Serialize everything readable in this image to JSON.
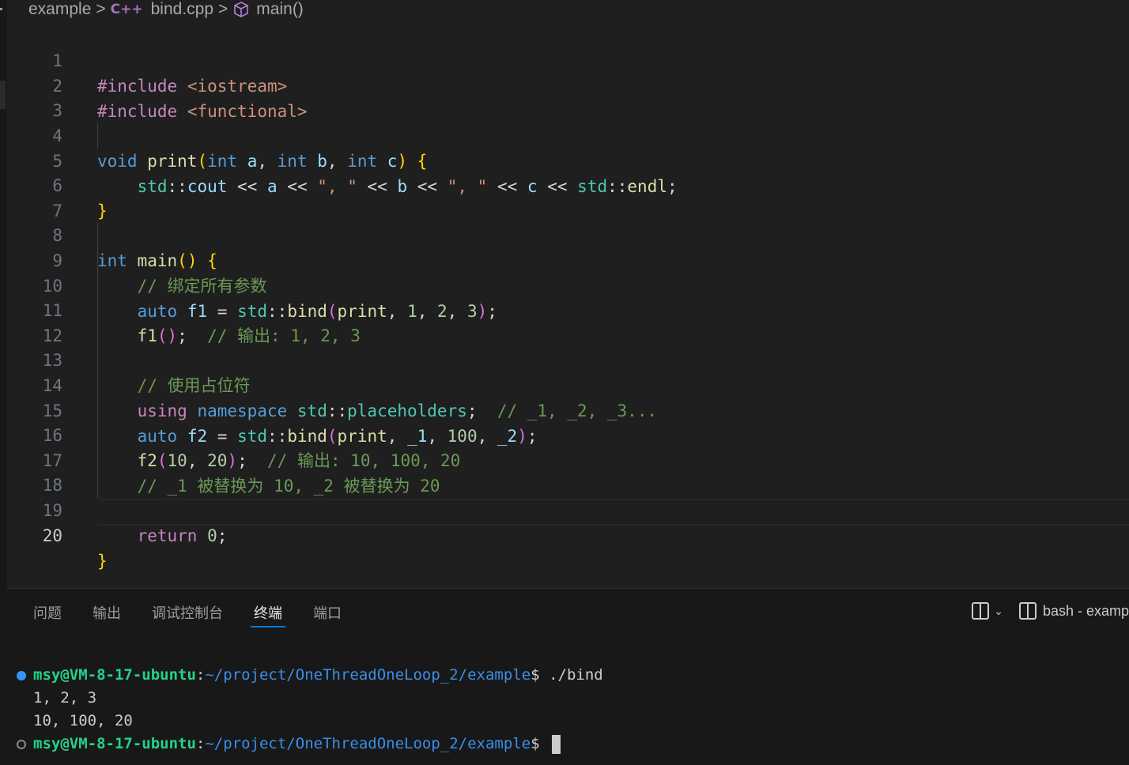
{
  "breadcrumb": {
    "folder": "example",
    "file_icon": "C++",
    "file": "bind.cpp",
    "symbol": "main()"
  },
  "editor": {
    "line_numbers": [
      "1",
      "2",
      "3",
      "4",
      "5",
      "6",
      "7",
      "8",
      "9",
      "10",
      "11",
      "12",
      "13",
      "14",
      "15",
      "16",
      "17",
      "18",
      "19",
      "20"
    ],
    "active_line": "20",
    "code": {
      "include_kw": "#include",
      "iostream": "<iostream>",
      "functional": "<functional>",
      "void": "void",
      "print": "print",
      "int": "int",
      "a": "a",
      "b": "b",
      "c": "c",
      "std": "std",
      "cout": "cout",
      "endl": "endl",
      "str_sep": "\", \"",
      "main": "main",
      "cmt_bind_all": "// 绑定所有参数",
      "auto": "auto",
      "f1": "f1",
      "bind": "bind",
      "n1": "1",
      "n2": "2",
      "n3": "3",
      "cmt_out1": "// 输出: 1, 2, 3",
      "cmt_placeholder": "// 使用占位符",
      "using": "using",
      "namespace": "namespace",
      "placeholders": "placeholders",
      "cmt_ph_list": "// _1, _2, _3...",
      "f2": "f2",
      "p1": "_1",
      "p2": "_2",
      "n100": "100",
      "n10": "10",
      "n20": "20",
      "cmt_out2": "// 输出: 10, 100, 20",
      "cmt_replace": "// _1 被替换为 10, _2 被替换为 20",
      "return": "return",
      "n0": "0"
    }
  },
  "panel": {
    "tabs": [
      "问题",
      "输出",
      "调试控制台",
      "终端",
      "端口"
    ],
    "active_tab": "终端",
    "terminal_label": "bash - examp"
  },
  "terminal": {
    "user_host": "msy@VM-8-17-ubuntu",
    "path": "~/project/OneThreadOneLoop_2/example",
    "prompt_suffix": "$",
    "command": " ./bind",
    "output_1": "1, 2, 3",
    "output_2": "10, 100, 20"
  },
  "colors": {
    "background": "#1f1f1f",
    "panel": "#181818",
    "accent": "#0078d4",
    "prompt_user": "#23d18b",
    "prompt_path": "#3b8eea"
  }
}
